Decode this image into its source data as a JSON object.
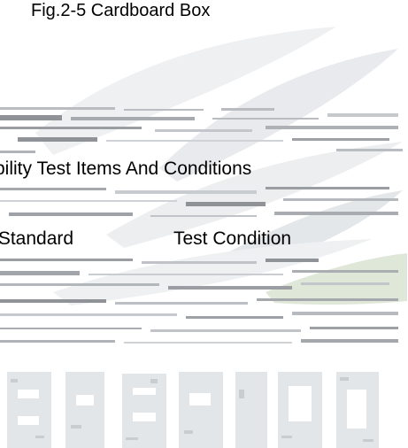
{
  "document": {
    "figure_caption": "Fig.2-5 Cardboard Box",
    "section_title": "bility Test Items And Conditions",
    "table_header": {
      "standard": ".Standard",
      "condition": "Test Condition"
    }
  },
  "colors": {
    "text": "#000000",
    "watermark_light": "#eceef0",
    "watermark_mid": "#cfd2d6",
    "watermark_dark": "#9a9ea3",
    "watermark_green": "#dfe8d8"
  }
}
